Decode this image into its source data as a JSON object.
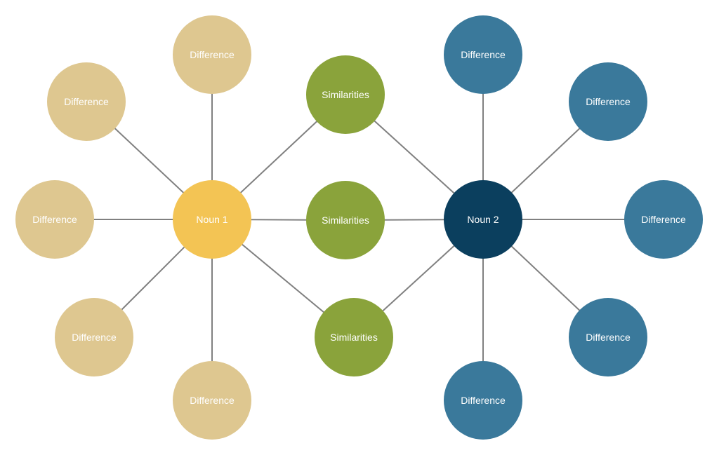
{
  "diagram": {
    "type": "double-bubble-map",
    "colors": {
      "noun1": "#f3c454",
      "noun2": "#0b3f5e",
      "difference1": "#dec790",
      "difference2": "#3a799b",
      "similarity": "#8aa33b",
      "connector": "#808080",
      "label": "#ffffff"
    },
    "nodes": [
      {
        "id": "noun1",
        "label": "Noun 1",
        "kind": "noun1"
      },
      {
        "id": "noun2",
        "label": "Noun 2",
        "kind": "noun2"
      },
      {
        "id": "sim-top",
        "label": "Similarities",
        "kind": "similarity"
      },
      {
        "id": "sim-mid",
        "label": "Similarities",
        "kind": "similarity"
      },
      {
        "id": "sim-bot",
        "label": "Similarities",
        "kind": "similarity"
      },
      {
        "id": "d1-top",
        "label": "Difference",
        "kind": "difference1"
      },
      {
        "id": "d1-upper-left",
        "label": "Difference",
        "kind": "difference1"
      },
      {
        "id": "d1-left",
        "label": "Difference",
        "kind": "difference1"
      },
      {
        "id": "d1-lower-left",
        "label": "Difference",
        "kind": "difference1"
      },
      {
        "id": "d1-bottom",
        "label": "Difference",
        "kind": "difference1"
      },
      {
        "id": "d2-top",
        "label": "Difference",
        "kind": "difference2"
      },
      {
        "id": "d2-upper-right",
        "label": "Difference",
        "kind": "difference2"
      },
      {
        "id": "d2-right",
        "label": "Difference",
        "kind": "difference2"
      },
      {
        "id": "d2-lower-right",
        "label": "Difference",
        "kind": "difference2"
      },
      {
        "id": "d2-bottom",
        "label": "Difference",
        "kind": "difference2"
      }
    ],
    "edges": [
      [
        "noun1",
        "d1-top"
      ],
      [
        "noun1",
        "d1-upper-left"
      ],
      [
        "noun1",
        "d1-left"
      ],
      [
        "noun1",
        "d1-lower-left"
      ],
      [
        "noun1",
        "d1-bottom"
      ],
      [
        "noun1",
        "sim-top"
      ],
      [
        "noun1",
        "sim-mid"
      ],
      [
        "noun1",
        "sim-bot"
      ],
      [
        "noun2",
        "sim-top"
      ],
      [
        "noun2",
        "sim-mid"
      ],
      [
        "noun2",
        "sim-bot"
      ],
      [
        "noun2",
        "d2-top"
      ],
      [
        "noun2",
        "d2-upper-right"
      ],
      [
        "noun2",
        "d2-right"
      ],
      [
        "noun2",
        "d2-lower-right"
      ],
      [
        "noun2",
        "d2-bottom"
      ]
    ]
  }
}
